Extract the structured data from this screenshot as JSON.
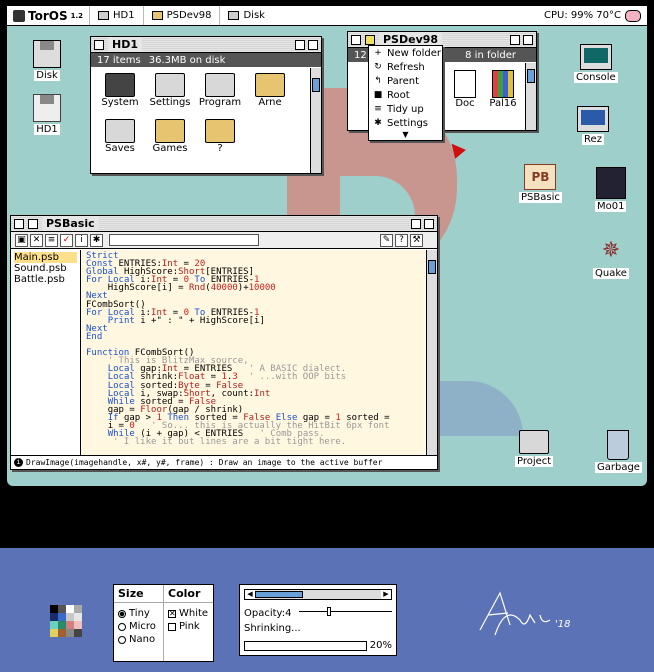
{
  "menubar": {
    "os_name": "TorOS",
    "os_version": "1.2",
    "items": [
      {
        "label": "HD1"
      },
      {
        "label": "PSDev98"
      },
      {
        "label": "Disk"
      }
    ],
    "status": "CPU: 99% 70°C"
  },
  "desktop": {
    "icons": [
      {
        "label": "Disk",
        "icon": "floppy-icon"
      },
      {
        "label": "HD1",
        "icon": "hard-disk-icon"
      },
      {
        "label": "Console",
        "icon": "monitor-icon"
      },
      {
        "label": "Rez",
        "icon": "monitor-icon"
      },
      {
        "label": "PSBasic",
        "icon": "psbasic-icon"
      },
      {
        "label": "Mo01",
        "icon": "creature-icon"
      },
      {
        "label": "Quake",
        "icon": "quake-icon"
      },
      {
        "label": "Project",
        "icon": "folder-icon"
      },
      {
        "label": "Garbage",
        "icon": "trash-icon"
      }
    ]
  },
  "hd1_window": {
    "title": "HD1",
    "info_count": "17 items",
    "info_size": "36.3MB on disk",
    "items": [
      {
        "label": "System"
      },
      {
        "label": "Settings"
      },
      {
        "label": "Program"
      },
      {
        "label": "Arne"
      },
      {
        "label": "Saves"
      },
      {
        "label": "Games"
      },
      {
        "label": "?"
      }
    ]
  },
  "psdev_window": {
    "title": "PSDev98",
    "info_left": "12",
    "info_right": "8 in folder",
    "items": [
      {
        "label": "Doc"
      },
      {
        "label": "Pal16"
      }
    ],
    "menu": [
      {
        "glyph": "+",
        "label": "New folder"
      },
      {
        "glyph": "↻",
        "label": "Refresh"
      },
      {
        "glyph": "↰",
        "label": "Parent"
      },
      {
        "glyph": "■",
        "label": "Root"
      },
      {
        "glyph": "≡",
        "label": "Tidy up"
      },
      {
        "glyph": "✱",
        "label": "Settings"
      }
    ]
  },
  "editor": {
    "title": "PSBasic",
    "files": [
      "Main.psb",
      "Sound.psb",
      "Battle.psb"
    ],
    "status": "DrawImage(imagehandle, x#, y#, frame) : Draw an image to the active buffer",
    "code_lines": [
      "Strict",
      "Const ENTRIES:Int = 20",
      "Global HighScore:Short[ENTRIES]",
      "For Local i:Int = 0 To ENTRIES-1",
      "    HighScore[i] = Rnd(40000)+10000",
      "Next",
      "FCombSort()",
      "For Local i:Int = 0 To ENTRIES-1",
      "    Print i +\" : \" + HighScore[i]",
      "Next",
      "End",
      "",
      "Function FCombSort()",
      "    ' This is BlitzMax source,",
      "    Local gap:Int = ENTRIES   ' A BASIC dialect.",
      "    Local shrink:Float = 1.3  ' ...with OOP bits",
      "    Local sorted:Byte = False",
      "    Local i, swap:Short, count:Int",
      "    While sorted = False",
      "    gap = Floor(gap / shrink)",
      "    If gap > 1 Then sorted = False Else gap = 1 sorted = ",
      "    i = 0   ' So... this is actually the HitBit 6px font",
      "    While (i + gap) < ENTRIES   ' Comb pass.",
      "     ' I like it but lines are a bit tight here."
    ]
  },
  "palette": {
    "size_header": "Size",
    "color_header": "Color",
    "sizes": [
      "Tiny",
      "Micro",
      "Nano"
    ],
    "selected_size": "Tiny",
    "colors": [
      "White",
      "Pink"
    ],
    "checked_color": "White",
    "opacity_label": "Opacity:4",
    "opacity_value": 4,
    "shrinking_label": "Shrinking...",
    "progress_percent": "20%",
    "progress_value": 0.2,
    "scroll_position": 0.38
  },
  "swatch_colors": [
    "#000000",
    "#555555",
    "#ffffff",
    "#aaaaaa",
    "#1a2a6a",
    "#3b6bc8",
    "#c8c8c8",
    "#e6e6e6",
    "#6ad0c0",
    "#2a8a6a",
    "#d08080",
    "#f0c0c0",
    "#e0d060",
    "#a06030",
    "#888888",
    "#444444"
  ],
  "signature_text": "Arne '18"
}
